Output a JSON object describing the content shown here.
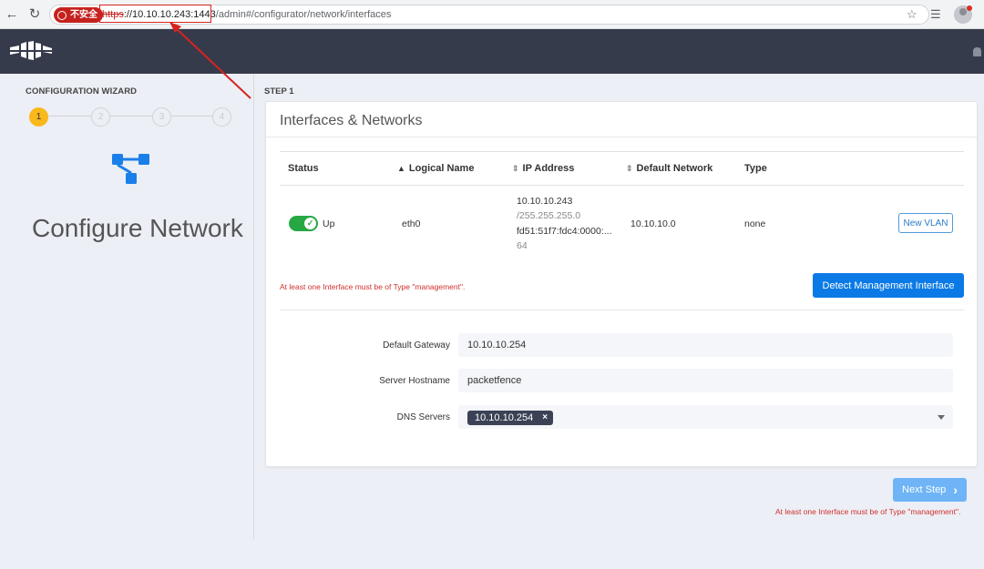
{
  "browser": {
    "security_label": "不安全",
    "url_scheme": "https",
    "url_host": "://10.10.10.243:1443",
    "url_path": "/admin#/configurator/network/interfaces",
    "colors": {
      "insecure": "#c5221f",
      "annotation": "#d6231f"
    }
  },
  "sidebar": {
    "wizard_title": "CONFIGURATION WIZARD",
    "steps": [
      {
        "label": "1",
        "state": "active"
      },
      {
        "label": "2",
        "state": "pending"
      },
      {
        "label": "3",
        "state": "pending"
      },
      {
        "label": "4",
        "state": "pending"
      }
    ],
    "section_icon": "network-topology-icon",
    "section_title": "Configure Network"
  },
  "main": {
    "step_label": "STEP 1",
    "card_title": "Interfaces & Networks",
    "table": {
      "headers": [
        "Status",
        "Logical Name",
        "IP Address",
        "Default Network",
        "Type"
      ],
      "rows": [
        {
          "status": "Up",
          "logical_name": "eth0",
          "ip_address": "10.10.10.243",
          "netmask": "/255.255.255.0",
          "ipv6": "fd51:51f7:fdc4:0000:...",
          "ipv6_prefix": "64",
          "default_network": "10.10.10.0",
          "type": "none",
          "action_label": "New VLAN"
        }
      ]
    },
    "warning": "At least one Interface must be of Type \"management\".",
    "detect_button": "Detect Management Interface",
    "form": {
      "gateway_label": "Default Gateway",
      "gateway_value": "10.10.10.254",
      "hostname_label": "Server Hostname",
      "hostname_value": "packetfence",
      "dns_label": "DNS Servers",
      "dns_servers": [
        "10.10.10.254"
      ],
      "dns_remove": "×"
    }
  },
  "footer": {
    "next_label": "Next Step",
    "warning": "At least one Interface must be of Type \"management\"."
  },
  "colors": {
    "primary": "#0b7ae6",
    "success": "#27a844",
    "step_active": "#f9b81b",
    "header": "#363b4c",
    "danger": "#d0312d"
  }
}
